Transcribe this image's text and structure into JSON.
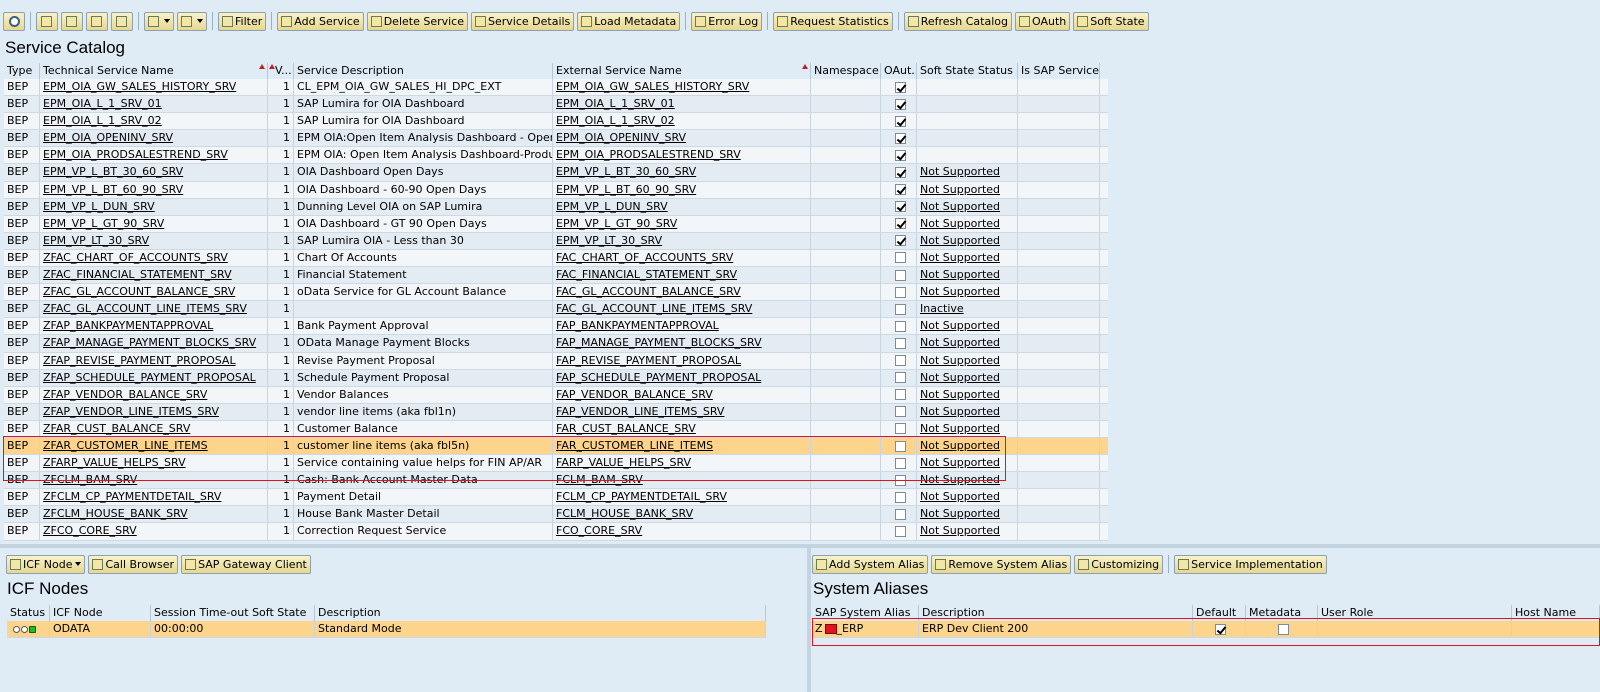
{
  "toolbar": {
    "buttons": [
      {
        "name": "filter-button",
        "label": "Filter"
      },
      {
        "name": "add-service-button",
        "label": "Add Service"
      },
      {
        "name": "delete-service-button",
        "label": "Delete Service"
      },
      {
        "name": "service-details-button",
        "label": "Service Details"
      },
      {
        "name": "load-metadata-button",
        "label": "Load Metadata"
      },
      {
        "name": "error-log-button",
        "label": "Error Log"
      },
      {
        "name": "request-statistics-button",
        "label": "Request Statistics"
      },
      {
        "name": "refresh-catalog-button",
        "label": "Refresh Catalog"
      },
      {
        "name": "oauth-button",
        "label": "OAuth"
      },
      {
        "name": "soft-state-button",
        "label": "Soft State"
      }
    ]
  },
  "catalog": {
    "title": "Service Catalog",
    "columns": {
      "type": "Type",
      "tech": "Technical Service Name",
      "v": "V...",
      "desc": "Service Description",
      "ext": "External Service Name",
      "ns": "Namespace",
      "oauth": "OAut...",
      "soft": "Soft State Status",
      "sap": "Is SAP Service"
    },
    "rows": [
      [
        "BEP",
        "EPM_OIA_GW_SALES_HISTORY_SRV",
        "1",
        "CL_EPM_OIA_GW_SALES_HI_DPC_EXT",
        "EPM_OIA_GW_SALES_HISTORY_SRV",
        "",
        true,
        ""
      ],
      [
        "BEP",
        "EPM_OIA_L_1_SRV_01",
        "1",
        "SAP Lumira for OIA Dashboard",
        "EPM_OIA_L_1_SRV_01",
        "",
        true,
        ""
      ],
      [
        "BEP",
        "EPM_OIA_L_1_SRV_02",
        "1",
        "SAP Lumira for OIA Dashboard",
        "EPM_OIA_L_1_SRV_02",
        "",
        true,
        ""
      ],
      [
        "BEP",
        "EPM_OIA_OPENINV_SRV",
        "1",
        "EPM OIA:Open Item Analysis Dashboard - Open In...",
        "EPM_OIA_OPENINV_SRV",
        "",
        true,
        ""
      ],
      [
        "BEP",
        "EPM_OIA_PRODSALESTREND_SRV",
        "1",
        "EPM OIA: Open Item Analysis Dashboard-Product...",
        "EPM_OIA_PRODSALESTREND_SRV",
        "",
        true,
        ""
      ],
      [
        "BEP",
        "EPM_VP_L_BT_30_60_SRV",
        "1",
        "OIA Dashboard Open Days",
        "EPM_VP_L_BT_30_60_SRV",
        "",
        true,
        "Not Supported"
      ],
      [
        "BEP",
        "EPM_VP_L_BT_60_90_SRV",
        "1",
        "OIA Dashboard - 60-90 Open Days",
        "EPM_VP_L_BT_60_90_SRV",
        "",
        true,
        "Not Supported"
      ],
      [
        "BEP",
        "EPM_VP_L_DUN_SRV",
        "1",
        "Dunning Level OIA on SAP Lumira",
        "EPM_VP_L_DUN_SRV",
        "",
        true,
        "Not Supported"
      ],
      [
        "BEP",
        "EPM_VP_L_GT_90_SRV",
        "1",
        "OIA Dashboard - GT 90 Open Days",
        "EPM_VP_L_GT_90_SRV",
        "",
        true,
        "Not Supported"
      ],
      [
        "BEP",
        "EPM_VP_LT_30_SRV",
        "1",
        "SAP Lumira OIA - Less than 30",
        "EPM_VP_LT_30_SRV",
        "",
        true,
        "Not Supported"
      ],
      [
        "BEP",
        "ZFAC_CHART_OF_ACCOUNTS_SRV",
        "1",
        "Chart Of Accounts",
        "FAC_CHART_OF_ACCOUNTS_SRV",
        "",
        false,
        "Not Supported"
      ],
      [
        "BEP",
        "ZFAC_FINANCIAL_STATEMENT_SRV",
        "1",
        "Financial Statement",
        "FAC_FINANCIAL_STATEMENT_SRV",
        "",
        false,
        "Not Supported"
      ],
      [
        "BEP",
        "ZFAC_GL_ACCOUNT_BALANCE_SRV",
        "1",
        "oData Service for GL Account Balance",
        "FAC_GL_ACCOUNT_BALANCE_SRV",
        "",
        false,
        "Not Supported"
      ],
      [
        "BEP",
        "ZFAC_GL_ACCOUNT_LINE_ITEMS_SRV",
        "1",
        "",
        "FAC_GL_ACCOUNT_LINE_ITEMS_SRV",
        "",
        false,
        "Inactive"
      ],
      [
        "BEP",
        "ZFAP_BANKPAYMENTAPPROVAL",
        "1",
        "Bank Payment Approval",
        "FAP_BANKPAYMENTAPPROVAL",
        "",
        false,
        "Not Supported"
      ],
      [
        "BEP",
        "ZFAP_MANAGE_PAYMENT_BLOCKS_SRV",
        "1",
        "OData Manage Payment Blocks",
        "FAP_MANAGE_PAYMENT_BLOCKS_SRV",
        "",
        false,
        "Not Supported"
      ],
      [
        "BEP",
        "ZFAP_REVISE_PAYMENT_PROPOSAL",
        "1",
        "Revise Payment Proposal",
        "FAP_REVISE_PAYMENT_PROPOSAL",
        "",
        false,
        "Not Supported"
      ],
      [
        "BEP",
        "ZFAP_SCHEDULE_PAYMENT_PROPOSAL",
        "1",
        "Schedule Payment Proposal",
        "FAP_SCHEDULE_PAYMENT_PROPOSAL",
        "",
        false,
        "Not Supported"
      ],
      [
        "BEP",
        "ZFAP_VENDOR_BALANCE_SRV",
        "1",
        "Vendor Balances",
        "FAP_VENDOR_BALANCE_SRV",
        "",
        false,
        "Not Supported"
      ],
      [
        "BEP",
        "ZFAP_VENDOR_LINE_ITEMS_SRV",
        "1",
        "vendor line items (aka fbl1n)",
        "FAP_VENDOR_LINE_ITEMS_SRV",
        "",
        false,
        "Not Supported"
      ],
      [
        "BEP",
        "ZFAR_CUST_BALANCE_SRV",
        "1",
        "Customer Balance",
        "FAR_CUST_BALANCE_SRV",
        "",
        false,
        "Not Supported"
      ],
      [
        "BEP",
        "ZFAR_CUSTOMER_LINE_ITEMS",
        "1",
        "customer line items (aka fbl5n)",
        "FAR_CUSTOMER_LINE_ITEMS",
        "",
        false,
        "Not Supported"
      ],
      [
        "BEP",
        "ZFARP_VALUE_HELPS_SRV",
        "1",
        "Service containing value helps for FIN AP/AR",
        "FARP_VALUE_HELPS_SRV",
        "",
        false,
        "Not Supported"
      ],
      [
        "BEP",
        "ZFCLM_BAM_SRV",
        "1",
        "Cash: Bank Account Master Data",
        "FCLM_BAM_SRV",
        "",
        false,
        "Not Supported"
      ],
      [
        "BEP",
        "ZFCLM_CP_PAYMENTDETAIL_SRV",
        "1",
        "Payment Detail",
        "FCLM_CP_PAYMENTDETAIL_SRV",
        "",
        false,
        "Not Supported"
      ],
      [
        "BEP",
        "ZFCLM_HOUSE_BANK_SRV",
        "1",
        "House Bank Master Detail",
        "FCLM_HOUSE_BANK_SRV",
        "",
        false,
        "Not Supported"
      ],
      [
        "BEP",
        "ZFCO_CORE_SRV",
        "1",
        "Correction Request Service",
        "FCO_CORE_SRV",
        "",
        false,
        "Not Supported"
      ]
    ],
    "selected_row": 21
  },
  "icf": {
    "toolbar": {
      "icf_node": "ICF Node",
      "call_browser": "Call Browser",
      "gateway_client": "SAP Gateway Client"
    },
    "title": "ICF Nodes",
    "columns": {
      "status": "Status",
      "node": "ICF Node",
      "timeout": "Session Time-out Soft State",
      "desc": "Description"
    },
    "row": {
      "node": "ODATA",
      "timeout": "00:00:00",
      "desc": "Standard Mode"
    }
  },
  "aliases": {
    "toolbar": {
      "add": "Add System Alias",
      "remove": "Remove System Alias",
      "customizing": "Customizing",
      "impl": "Service Implementation"
    },
    "title": "System Aliases",
    "columns": {
      "alias": "SAP System Alias",
      "desc": "Description",
      "def": "Default",
      "meta": "Metadata",
      "role": "User Role",
      "host": "Host Name"
    },
    "row": {
      "alias_prefix": "Z",
      "alias_suffix": "_ERP",
      "desc": "ERP Dev Client 200",
      "default": true,
      "metadata": false
    }
  }
}
